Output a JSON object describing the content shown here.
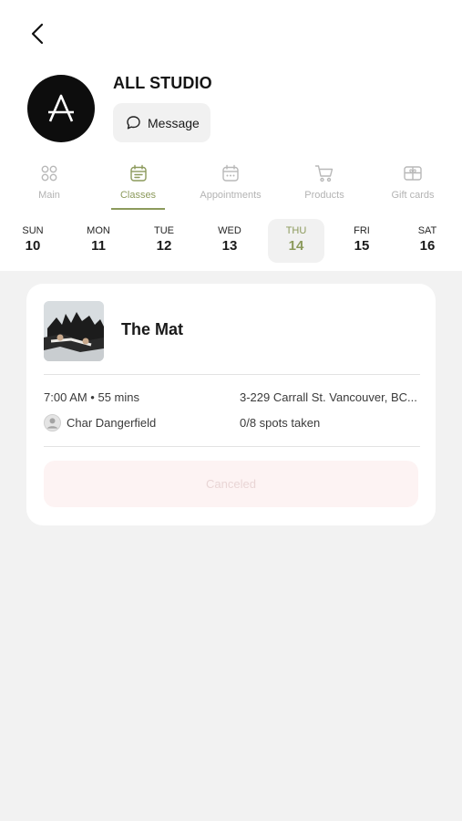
{
  "header": {
    "studio_name": "ALL STUDIO",
    "message_label": "Message"
  },
  "tabs": [
    {
      "label": "Main",
      "icon": "grid-icon",
      "active": false
    },
    {
      "label": "Classes",
      "icon": "calendar-list-icon",
      "active": true
    },
    {
      "label": "Appointments",
      "icon": "calendar-icon",
      "active": false
    },
    {
      "label": "Products",
      "icon": "cart-icon",
      "active": false
    },
    {
      "label": "Gift cards",
      "icon": "gift-card-icon",
      "active": false
    }
  ],
  "days": [
    {
      "name": "SUN",
      "date": "10"
    },
    {
      "name": "MON",
      "date": "11"
    },
    {
      "name": "TUE",
      "date": "12"
    },
    {
      "name": "WED",
      "date": "13"
    },
    {
      "name": "THU",
      "date": "14"
    },
    {
      "name": "FRI",
      "date": "15"
    },
    {
      "name": "SAT",
      "date": "16"
    }
  ],
  "selected_day": "THU",
  "class_card": {
    "title": "The Mat",
    "time": "7:00 AM • 55 mins",
    "address": "3-229 Carrall St. Vancouver, BC...",
    "instructor": "Char Dangerfield",
    "spots": "0/8 spots taken",
    "status_label": "Canceled"
  },
  "colors": {
    "accent": "#8c9a5c",
    "background": "#f2f2f2",
    "card": "#ffffff",
    "canceled_bg": "#fdf3f3"
  }
}
